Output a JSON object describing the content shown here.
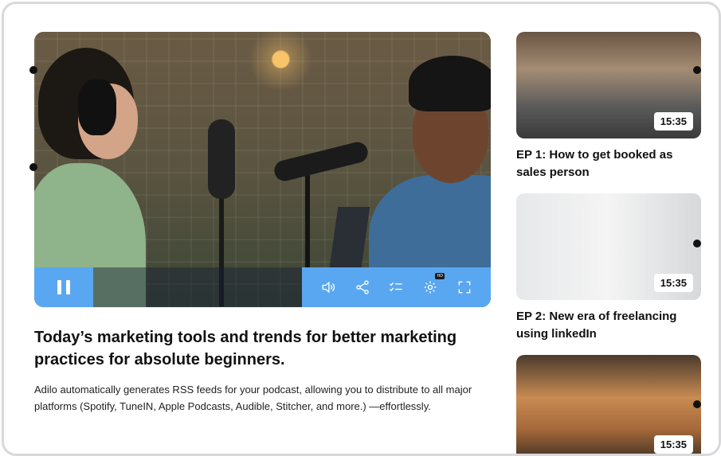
{
  "main_video": {
    "controls": {
      "pause_icon": "pause-icon",
      "volume_icon": "volume-icon",
      "share_icon": "share-icon",
      "playlist_icon": "playlist-icon",
      "settings_icon": "settings-icon",
      "hd_badge": "HD",
      "fullscreen_icon": "fullscreen-icon"
    },
    "title": "Today’s marketing tools and trends for better marketing practices for absolute beginners.",
    "description": "Adilo automatically generates RSS feeds for your podcast, allowing you to distribute to all major platforms (Spotify, TuneIN, Apple Podcasts, Audible, Stitcher, and more.) —effortlessly."
  },
  "episodes": [
    {
      "duration": "15:35",
      "title": "EP 1: How to get booked as sales person"
    },
    {
      "duration": "15:35",
      "title": "EP 2: New era of freelancing using linkedIn"
    },
    {
      "duration": "15:35",
      "title": ""
    }
  ],
  "colors": {
    "accent": "#5aa7f1",
    "text": "#111111",
    "border": "#d9d9dc"
  }
}
